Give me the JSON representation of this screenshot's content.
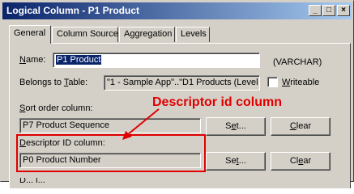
{
  "window": {
    "title": "Logical Column - P1  Product",
    "controls": [
      "_",
      "□",
      "×"
    ]
  },
  "tabs": [
    {
      "label": "General",
      "active": true
    },
    {
      "label": "Column Source",
      "active": false
    },
    {
      "label": "Aggregation",
      "active": false
    },
    {
      "label": "Levels",
      "active": false
    }
  ],
  "form": {
    "name_label_pre": "",
    "name_label_ul": "N",
    "name_label_post": "ame:",
    "name_value": "P1  Product",
    "type_label": "(VARCHAR)",
    "belongs_label_pre": "Belongs to ",
    "belongs_label_ul": "T",
    "belongs_label_post": "able:",
    "belongs_value": "\"1 - Sample App\"..\"D1 Products (Level",
    "writeable_ul": "W",
    "writeable_post": "riteable",
    "writeable_checked": false,
    "sort_label_pre": "",
    "sort_label_ul": "S",
    "sort_label_post": "ort order column:",
    "sort_value": "P7  Product Sequence",
    "sort_set_pre": "S",
    "sort_set_ul": "e",
    "sort_set_post": "t...",
    "sort_clear_pre": "",
    "sort_clear_ul": "C",
    "sort_clear_post": "lear",
    "descriptor_label_pre": "",
    "descriptor_label_ul": "D",
    "descriptor_label_post": "escriptor ID column:",
    "descriptor_value": "P0  Product Number",
    "desc_set_pre": "Se",
    "desc_set_ul": "t",
    "desc_set_post": "...",
    "desc_clear_pre": "Cl",
    "desc_clear_ul": "e",
    "desc_clear_post": "ar",
    "partial_label": "D...   l..."
  },
  "annotation": {
    "text": "Descriptor id column",
    "color": "#e00000"
  }
}
